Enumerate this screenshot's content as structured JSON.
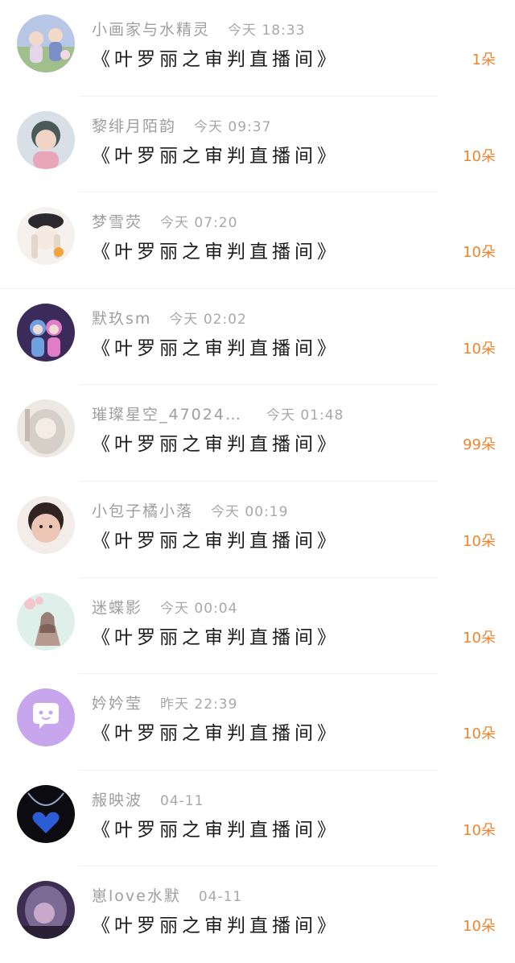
{
  "records": [
    {
      "name": "小画家与水精灵",
      "time": "今天 18:33",
      "title": "《叶罗丽之审判直播间》",
      "count": "1朵",
      "avatar_icon": "fairy-group-avatar",
      "avatar_colors": [
        "#b9c7e6",
        "#e8d4e9",
        "#7d8fc7"
      ]
    },
    {
      "name": "黎绯月陌韵",
      "time": "今天 09:37",
      "title": "《叶罗丽之审判直播间》",
      "count": "10朵",
      "avatar_icon": "child-photo-avatar",
      "avatar_colors": [
        "#d8dfe6",
        "#4a5a58",
        "#e8a6b8"
      ]
    },
    {
      "name": "梦雪荧",
      "time": "今天 07:20",
      "title": "《叶罗丽之审判直播间》",
      "count": "10朵",
      "avatar_icon": "anime-girl-hat-avatar",
      "avatar_colors": [
        "#f4f1ee",
        "#2a2a2e",
        "#e2d7c8"
      ]
    },
    {
      "name": "默玖sm",
      "time": "今天 02:02",
      "title": "《叶罗丽之审判直播间》",
      "count": "10朵",
      "avatar_icon": "doll-pair-avatar",
      "avatar_colors": [
        "#3b2b5a",
        "#6fa0e0",
        "#e07cc8"
      ]
    },
    {
      "name": "璀璨星空_47024…",
      "time": "今天 01:48",
      "title": "《叶罗丽之审判直播间》",
      "count": "99朵",
      "avatar_icon": "white-hair-girl-avatar",
      "avatar_colors": [
        "#ece8e2",
        "#d6cfc7",
        "#c9b9ad"
      ]
    },
    {
      "name": "小包子橘小落",
      "time": "今天 00:19",
      "title": "《叶罗丽之审判直播间》",
      "count": "10朵",
      "avatar_icon": "baby-photo-avatar",
      "avatar_colors": [
        "#f3ece8",
        "#2f2420",
        "#edc5b5"
      ]
    },
    {
      "name": "迷蝶影",
      "time": "今天 00:04",
      "title": "《叶罗丽之审判直播间》",
      "count": "10朵",
      "avatar_icon": "blossom-girl-avatar",
      "avatar_colors": [
        "#dff0ea",
        "#f2c6cc",
        "#b79a8f"
      ]
    },
    {
      "name": "妗妗莹",
      "time": "昨天 22:39",
      "title": "《叶罗丽之审判直播间》",
      "count": "10朵",
      "avatar_icon": "chat-bubble-avatar",
      "avatar_colors": [
        "#c7a6ee",
        "#ffffff",
        "#c7a6ee"
      ]
    },
    {
      "name": "赧映波",
      "time": "04-11",
      "title": "《叶罗丽之审判直播间》",
      "count": "10朵",
      "avatar_icon": "heart-necklace-avatar",
      "avatar_colors": [
        "#0c0c10",
        "#2b5dd6",
        "#8fa6c8"
      ]
    },
    {
      "name": "崽love水默",
      "time": "04-11",
      "title": "《叶罗丽之审判直播间》",
      "count": "10朵",
      "avatar_icon": "dark-anime-avatar",
      "avatar_colors": [
        "#3e2d52",
        "#7b6a93",
        "#c9a9c9"
      ]
    }
  ]
}
